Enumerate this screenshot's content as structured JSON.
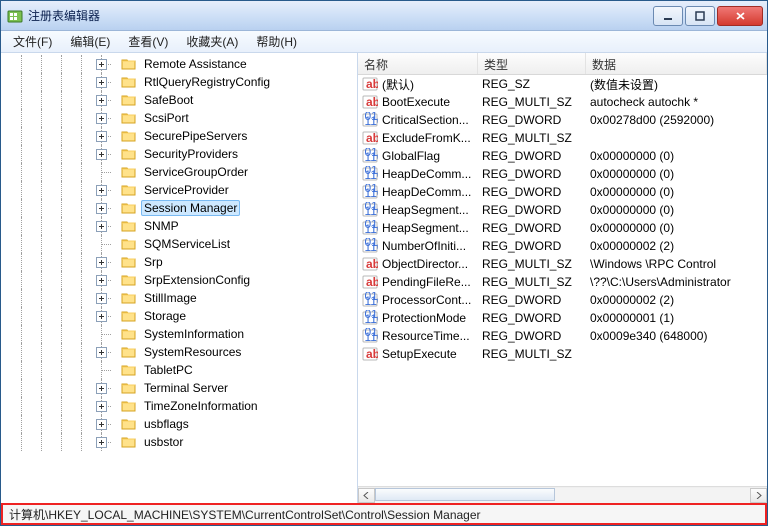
{
  "title": "注册表编辑器",
  "menu": {
    "file": "文件(F)",
    "edit": "编辑(E)",
    "view": "查看(V)",
    "favorites": "收藏夹(A)",
    "help": "帮助(H)"
  },
  "tree": {
    "items": [
      {
        "label": "Remote Assistance",
        "exp": "plus"
      },
      {
        "label": "RtlQueryRegistryConfig",
        "exp": "plus"
      },
      {
        "label": "SafeBoot",
        "exp": "plus"
      },
      {
        "label": "ScsiPort",
        "exp": "plus"
      },
      {
        "label": "SecurePipeServers",
        "exp": "plus"
      },
      {
        "label": "SecurityProviders",
        "exp": "plus"
      },
      {
        "label": "ServiceGroupOrder",
        "exp": "none"
      },
      {
        "label": "ServiceProvider",
        "exp": "plus"
      },
      {
        "label": "Session Manager",
        "exp": "plus",
        "selected": true
      },
      {
        "label": "SNMP",
        "exp": "plus"
      },
      {
        "label": "SQMServiceList",
        "exp": "none"
      },
      {
        "label": "Srp",
        "exp": "plus"
      },
      {
        "label": "SrpExtensionConfig",
        "exp": "plus"
      },
      {
        "label": "StillImage",
        "exp": "plus"
      },
      {
        "label": "Storage",
        "exp": "plus"
      },
      {
        "label": "SystemInformation",
        "exp": "none"
      },
      {
        "label": "SystemResources",
        "exp": "plus"
      },
      {
        "label": "TabletPC",
        "exp": "none"
      },
      {
        "label": "Terminal Server",
        "exp": "plus"
      },
      {
        "label": "TimeZoneInformation",
        "exp": "plus"
      },
      {
        "label": "usbflags",
        "exp": "plus"
      },
      {
        "label": "usbstor",
        "exp": "plus"
      }
    ]
  },
  "columns": {
    "name": "名称",
    "type": "类型",
    "data": "数据"
  },
  "values": [
    {
      "icon": "sz",
      "name": "(默认)",
      "type": "REG_SZ",
      "data": "(数值未设置)"
    },
    {
      "icon": "sz",
      "name": "BootExecute",
      "type": "REG_MULTI_SZ",
      "data": "autocheck autochk *"
    },
    {
      "icon": "bin",
      "name": "CriticalSection...",
      "type": "REG_DWORD",
      "data": "0x00278d00 (2592000)"
    },
    {
      "icon": "sz",
      "name": "ExcludeFromK...",
      "type": "REG_MULTI_SZ",
      "data": ""
    },
    {
      "icon": "bin",
      "name": "GlobalFlag",
      "type": "REG_DWORD",
      "data": "0x00000000 (0)"
    },
    {
      "icon": "bin",
      "name": "HeapDeComm...",
      "type": "REG_DWORD",
      "data": "0x00000000 (0)"
    },
    {
      "icon": "bin",
      "name": "HeapDeComm...",
      "type": "REG_DWORD",
      "data": "0x00000000 (0)"
    },
    {
      "icon": "bin",
      "name": "HeapSegment...",
      "type": "REG_DWORD",
      "data": "0x00000000 (0)"
    },
    {
      "icon": "bin",
      "name": "HeapSegment...",
      "type": "REG_DWORD",
      "data": "0x00000000 (0)"
    },
    {
      "icon": "bin",
      "name": "NumberOfIniti...",
      "type": "REG_DWORD",
      "data": "0x00000002 (2)"
    },
    {
      "icon": "sz",
      "name": "ObjectDirector...",
      "type": "REG_MULTI_SZ",
      "data": "\\Windows \\RPC Control"
    },
    {
      "icon": "sz",
      "name": "PendingFileRe...",
      "type": "REG_MULTI_SZ",
      "data": "\\??\\C:\\Users\\Administrator"
    },
    {
      "icon": "bin",
      "name": "ProcessorCont...",
      "type": "REG_DWORD",
      "data": "0x00000002 (2)"
    },
    {
      "icon": "bin",
      "name": "ProtectionMode",
      "type": "REG_DWORD",
      "data": "0x00000001 (1)"
    },
    {
      "icon": "bin",
      "name": "ResourceTime...",
      "type": "REG_DWORD",
      "data": "0x0009e340 (648000)"
    },
    {
      "icon": "sz",
      "name": "SetupExecute",
      "type": "REG_MULTI_SZ",
      "data": ""
    }
  ],
  "status": "计算机\\HKEY_LOCAL_MACHINE\\SYSTEM\\CurrentControlSet\\Control\\Session Manager"
}
